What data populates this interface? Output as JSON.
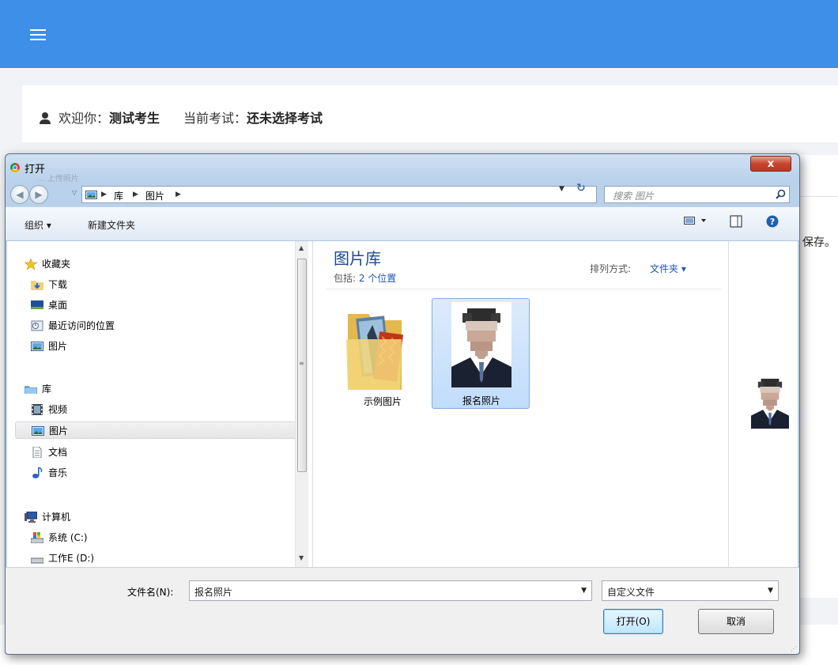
{
  "page": {
    "welcome_label": "欢迎你：",
    "user_name": "测试考生",
    "exam_label": "当前考试：",
    "exam_value": "还未选择考试",
    "save_snippet": "保存。"
  },
  "dialog": {
    "title": "打开",
    "ghost_text": "...    上传照片",
    "close_label": "x",
    "address": {
      "crumbs": [
        "库",
        "图片"
      ]
    },
    "search_placeholder": "搜索 图片",
    "toolbar": {
      "organize": "组织 ▾",
      "new_folder": "新建文件夹"
    },
    "nav_pane": {
      "items": [
        {
          "label": "收藏夹",
          "icon": "star-icon"
        },
        {
          "label": "下载",
          "icon": "download-folder-icon"
        },
        {
          "label": "桌面",
          "icon": "desktop-icon"
        },
        {
          "label": "最近访问的位置",
          "icon": "recent-places-icon"
        },
        {
          "label": "图片",
          "icon": "pictures-icon"
        },
        {
          "label": "库",
          "icon": "library-icon"
        },
        {
          "label": "视频",
          "icon": "video-icon"
        },
        {
          "label": "图片",
          "icon": "pictures-icon",
          "selected": true
        },
        {
          "label": "文档",
          "icon": "document-icon"
        },
        {
          "label": "音乐",
          "icon": "music-icon"
        },
        {
          "label": "计算机",
          "icon": "computer-icon"
        },
        {
          "label": "系统 (C:)",
          "icon": "drive-c-icon"
        },
        {
          "label": "工作E (D:)",
          "icon": "drive-d-icon"
        }
      ]
    },
    "main": {
      "library_title": "图片库",
      "includes_prefix": "包括: ",
      "includes_link": "2 个位置",
      "sort_label": "排列方式:",
      "sort_value": "文件夹 ▾",
      "files": [
        {
          "label": "示例图片",
          "icon": "folder-icon",
          "selected": false
        },
        {
          "label": "报名照片",
          "icon": "photo-thumbnail-icon",
          "selected": true
        }
      ]
    },
    "footer": {
      "filename_label": "文件名(N):",
      "filename_value": "报名照片",
      "filetype_value": "自定义文件",
      "open_label": "打开(O)",
      "cancel_label": "取消"
    }
  }
}
